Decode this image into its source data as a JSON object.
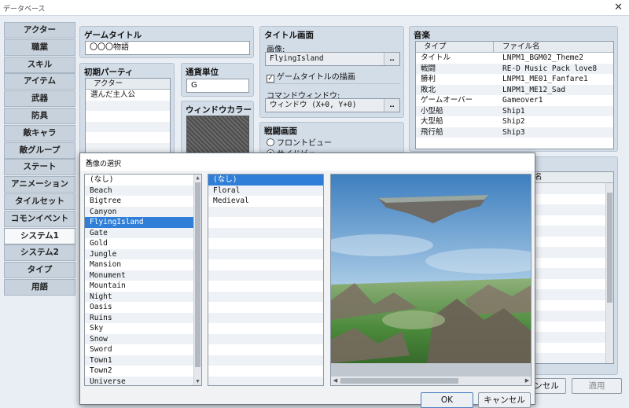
{
  "window": {
    "title": "データベース",
    "close": "✕"
  },
  "sidebar": [
    {
      "label": "アクター"
    },
    {
      "label": "職業"
    },
    {
      "label": "スキル"
    },
    {
      "label": "アイテム"
    },
    {
      "label": "武器"
    },
    {
      "label": "防具"
    },
    {
      "label": "敵キャラ"
    },
    {
      "label": "敵グループ"
    },
    {
      "label": "ステート"
    },
    {
      "label": "アニメーション"
    },
    {
      "label": "タイルセット"
    },
    {
      "label": "コモンイベント"
    },
    {
      "label": "システム1"
    },
    {
      "label": "システム2"
    },
    {
      "label": "タイプ"
    },
    {
      "label": "用語"
    }
  ],
  "game_title": {
    "label": "ゲームタイトル",
    "value": "〇〇〇物語"
  },
  "party": {
    "label": "初期パーティ",
    "column": "アクター",
    "rows": [
      "選んだ主人公"
    ]
  },
  "currency": {
    "label": "通貨単位",
    "value": "G"
  },
  "window_color": {
    "label": "ウィンドウカラー"
  },
  "title_screen": {
    "label": "タイトル画面",
    "image_label": "画像:",
    "image_value": "FlyingIsland",
    "dots": "…",
    "draw_title": "ゲームタイトルの描画",
    "command_label": "コマンドウィンドウ:",
    "command_value": "ウィンドウ (X+0, Y+0)"
  },
  "battle_screen": {
    "label": "戦闘画面",
    "front": "フロントビュー",
    "side": "サイドビュー"
  },
  "music": {
    "label": "音楽",
    "col_type": "タイプ",
    "col_file": "ファイル名",
    "rows": [
      {
        "type": "タイトル",
        "file": "LNPM1_BGM02_Theme2"
      },
      {
        "type": "戦闘",
        "file": "RE-D Music Pack love8"
      },
      {
        "type": "勝利",
        "file": "LNPM1_ME01_Fanfare1"
      },
      {
        "type": "敗北",
        "file": "LNPM1_ME12_Sad"
      },
      {
        "type": "ゲームオーバー",
        "file": "Gameover1"
      },
      {
        "type": "小型船",
        "file": "Ship1"
      },
      {
        "type": "大型船",
        "file": "Ship2"
      },
      {
        "type": "飛行船",
        "file": "Ship3"
      }
    ]
  },
  "se_partial_header": "名",
  "main_buttons": {
    "cancel": "ンセル",
    "apply": "適用"
  },
  "dialog": {
    "title": "画像の選択",
    "close": "✕",
    "list1": [
      "(なし)",
      "Beach",
      "Bigtree",
      "Canyon",
      "FlyingIsland",
      "Gate",
      "Gold",
      "Jungle",
      "Mansion",
      "Monument",
      "Mountain",
      "Night",
      "Oasis",
      "Ruins",
      "Sky",
      "Snow",
      "Sword",
      "Town1",
      "Town2",
      "Universe"
    ],
    "list1_selected": "FlyingIsland",
    "list2": [
      "(なし)",
      "Floral",
      "Medieval"
    ],
    "list2_selected": "(なし)",
    "ok": "OK",
    "cancel": "キャンセル"
  }
}
